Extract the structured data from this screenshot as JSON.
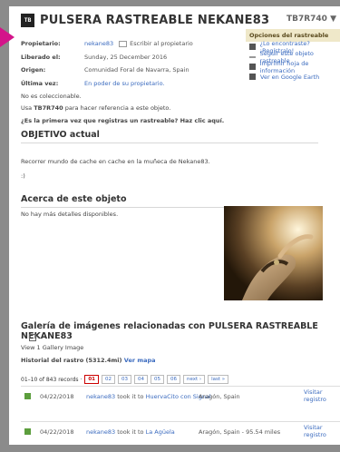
{
  "header": {
    "title": "PULSERA RASTREABLE NEKANE83",
    "code": "TB7R740 ▼",
    "icon_glyph": "TB"
  },
  "info": [
    {
      "label": "Propietario:",
      "value": "nekane83",
      "extra": "Escribir al propietario"
    },
    {
      "label": "Liberado el:",
      "value": "Sunday, 25 December 2016"
    },
    {
      "label": "Origen:",
      "value": "Comunidad Foral de Navarra, Spain"
    },
    {
      "label": "Última vez:",
      "value": "En poder de su propietario."
    }
  ],
  "options": {
    "heading": "Opciones del rastreable",
    "items": [
      {
        "label": "¿Lo encontraste? ¡Regístralo!",
        "icon": "clipboard-icon"
      },
      {
        "label": "Seguir este objeto rastreable",
        "icon": "watch-icon"
      },
      {
        "label": "Imprimir hoja de información",
        "icon": "printer-icon"
      },
      {
        "label": "Ver en Google Earth",
        "icon": "globe-icon"
      }
    ]
  },
  "body": {
    "not_collectible": "No es coleccionable.",
    "use_prefix": "Usa ",
    "use_code": "TB7R740",
    "use_suffix": " para hacer referencia a este objeto.",
    "first_time": "¿Es la primera vez que registras un rastreable? Haz clic aquí.",
    "goal_heading": "OBJETIVO actual",
    "goal_text": "Recorrer mundo de cache en cache en la muñeca de Nekane83.",
    "smile": ":)",
    "about_heading": "Acerca de este objeto",
    "about_text": "No hay más detalles disponibles.",
    "gallery_heading": "Galería de imágenes relacionadas con PULSERA RASTREABLE NEKANE83",
    "gallery_link": "View 1 Gallery Image",
    "history_prefix": "Historial del rastro (5312.4mi) ",
    "history_link": "Ver mapa"
  },
  "pager": {
    "summary": "01–10 of 843 records ·",
    "pages": [
      "01",
      "02",
      "03",
      "04",
      "05",
      "06",
      "next ›",
      "last »"
    ]
  },
  "logs": [
    {
      "date": "04/22/2018",
      "user": "nekane83",
      "action": " took it to ",
      "place": "HuervaCito con Signal",
      "location": "Aragón, Spain",
      "visit": "Visitar registro"
    },
    {
      "date": "04/22/2018",
      "user": "nekane83",
      "action": " took it to ",
      "place": "La Agüela",
      "location": "Aragón, Spain - 95.54 miles",
      "visit": "Visitar registro"
    }
  ]
}
